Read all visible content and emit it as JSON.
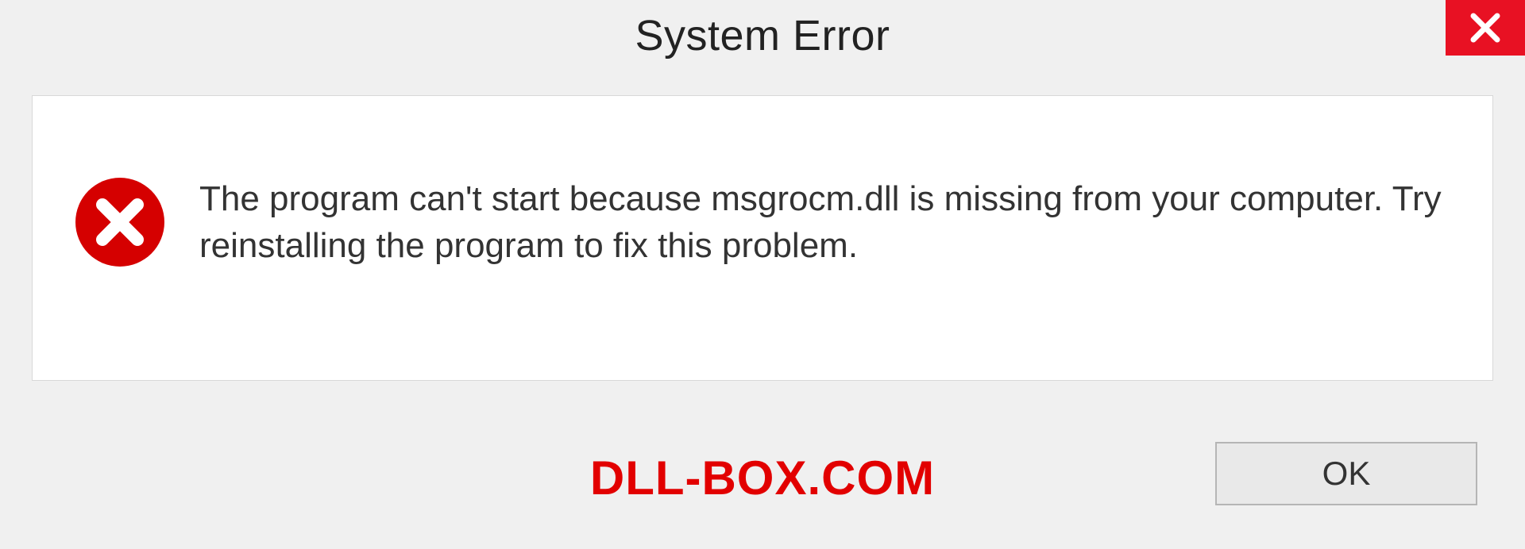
{
  "titlebar": {
    "title": "System Error",
    "close_icon": "close-icon"
  },
  "content": {
    "error_icon": "error-cross-icon",
    "message": "The program can't start because msgrocm.dll is missing from your computer. Try reinstalling the program to fix this problem."
  },
  "footer": {
    "watermark": "DLL-BOX.COM",
    "ok_label": "OK"
  },
  "colors": {
    "accent_red": "#e81123",
    "error_red": "#d50000",
    "watermark_red": "#e20000"
  }
}
